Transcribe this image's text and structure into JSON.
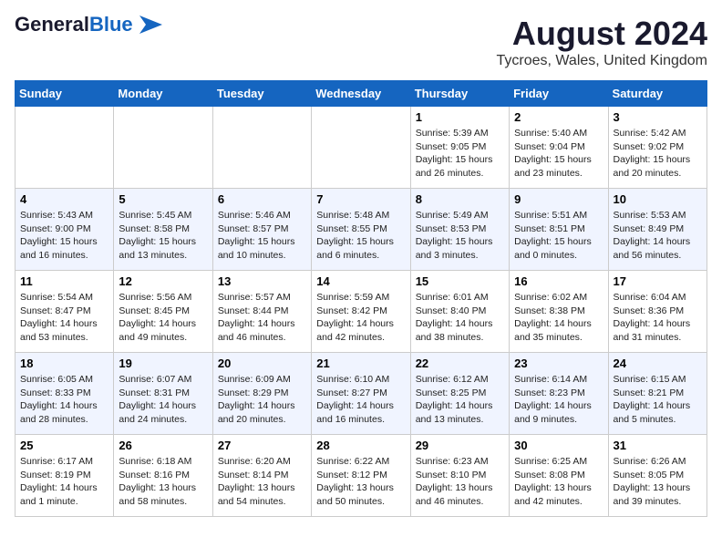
{
  "logo": {
    "line1": "General",
    "line2": "Blue"
  },
  "header": {
    "month_year": "August 2024",
    "location": "Tycroes, Wales, United Kingdom"
  },
  "weekdays": [
    "Sunday",
    "Monday",
    "Tuesday",
    "Wednesday",
    "Thursday",
    "Friday",
    "Saturday"
  ],
  "weeks": [
    [
      {
        "day": "",
        "info": ""
      },
      {
        "day": "",
        "info": ""
      },
      {
        "day": "",
        "info": ""
      },
      {
        "day": "",
        "info": ""
      },
      {
        "day": "1",
        "info": "Sunrise: 5:39 AM\nSunset: 9:05 PM\nDaylight: 15 hours\nand 26 minutes."
      },
      {
        "day": "2",
        "info": "Sunrise: 5:40 AM\nSunset: 9:04 PM\nDaylight: 15 hours\nand 23 minutes."
      },
      {
        "day": "3",
        "info": "Sunrise: 5:42 AM\nSunset: 9:02 PM\nDaylight: 15 hours\nand 20 minutes."
      }
    ],
    [
      {
        "day": "4",
        "info": "Sunrise: 5:43 AM\nSunset: 9:00 PM\nDaylight: 15 hours\nand 16 minutes."
      },
      {
        "day": "5",
        "info": "Sunrise: 5:45 AM\nSunset: 8:58 PM\nDaylight: 15 hours\nand 13 minutes."
      },
      {
        "day": "6",
        "info": "Sunrise: 5:46 AM\nSunset: 8:57 PM\nDaylight: 15 hours\nand 10 minutes."
      },
      {
        "day": "7",
        "info": "Sunrise: 5:48 AM\nSunset: 8:55 PM\nDaylight: 15 hours\nand 6 minutes."
      },
      {
        "day": "8",
        "info": "Sunrise: 5:49 AM\nSunset: 8:53 PM\nDaylight: 15 hours\nand 3 minutes."
      },
      {
        "day": "9",
        "info": "Sunrise: 5:51 AM\nSunset: 8:51 PM\nDaylight: 15 hours\nand 0 minutes."
      },
      {
        "day": "10",
        "info": "Sunrise: 5:53 AM\nSunset: 8:49 PM\nDaylight: 14 hours\nand 56 minutes."
      }
    ],
    [
      {
        "day": "11",
        "info": "Sunrise: 5:54 AM\nSunset: 8:47 PM\nDaylight: 14 hours\nand 53 minutes."
      },
      {
        "day": "12",
        "info": "Sunrise: 5:56 AM\nSunset: 8:45 PM\nDaylight: 14 hours\nand 49 minutes."
      },
      {
        "day": "13",
        "info": "Sunrise: 5:57 AM\nSunset: 8:44 PM\nDaylight: 14 hours\nand 46 minutes."
      },
      {
        "day": "14",
        "info": "Sunrise: 5:59 AM\nSunset: 8:42 PM\nDaylight: 14 hours\nand 42 minutes."
      },
      {
        "day": "15",
        "info": "Sunrise: 6:01 AM\nSunset: 8:40 PM\nDaylight: 14 hours\nand 38 minutes."
      },
      {
        "day": "16",
        "info": "Sunrise: 6:02 AM\nSunset: 8:38 PM\nDaylight: 14 hours\nand 35 minutes."
      },
      {
        "day": "17",
        "info": "Sunrise: 6:04 AM\nSunset: 8:36 PM\nDaylight: 14 hours\nand 31 minutes."
      }
    ],
    [
      {
        "day": "18",
        "info": "Sunrise: 6:05 AM\nSunset: 8:33 PM\nDaylight: 14 hours\nand 28 minutes."
      },
      {
        "day": "19",
        "info": "Sunrise: 6:07 AM\nSunset: 8:31 PM\nDaylight: 14 hours\nand 24 minutes."
      },
      {
        "day": "20",
        "info": "Sunrise: 6:09 AM\nSunset: 8:29 PM\nDaylight: 14 hours\nand 20 minutes."
      },
      {
        "day": "21",
        "info": "Sunrise: 6:10 AM\nSunset: 8:27 PM\nDaylight: 14 hours\nand 16 minutes."
      },
      {
        "day": "22",
        "info": "Sunrise: 6:12 AM\nSunset: 8:25 PM\nDaylight: 14 hours\nand 13 minutes."
      },
      {
        "day": "23",
        "info": "Sunrise: 6:14 AM\nSunset: 8:23 PM\nDaylight: 14 hours\nand 9 minutes."
      },
      {
        "day": "24",
        "info": "Sunrise: 6:15 AM\nSunset: 8:21 PM\nDaylight: 14 hours\nand 5 minutes."
      }
    ],
    [
      {
        "day": "25",
        "info": "Sunrise: 6:17 AM\nSunset: 8:19 PM\nDaylight: 14 hours\nand 1 minute."
      },
      {
        "day": "26",
        "info": "Sunrise: 6:18 AM\nSunset: 8:16 PM\nDaylight: 13 hours\nand 58 minutes."
      },
      {
        "day": "27",
        "info": "Sunrise: 6:20 AM\nSunset: 8:14 PM\nDaylight: 13 hours\nand 54 minutes."
      },
      {
        "day": "28",
        "info": "Sunrise: 6:22 AM\nSunset: 8:12 PM\nDaylight: 13 hours\nand 50 minutes."
      },
      {
        "day": "29",
        "info": "Sunrise: 6:23 AM\nSunset: 8:10 PM\nDaylight: 13 hours\nand 46 minutes."
      },
      {
        "day": "30",
        "info": "Sunrise: 6:25 AM\nSunset: 8:08 PM\nDaylight: 13 hours\nand 42 minutes."
      },
      {
        "day": "31",
        "info": "Sunrise: 6:26 AM\nSunset: 8:05 PM\nDaylight: 13 hours\nand 39 minutes."
      }
    ]
  ]
}
